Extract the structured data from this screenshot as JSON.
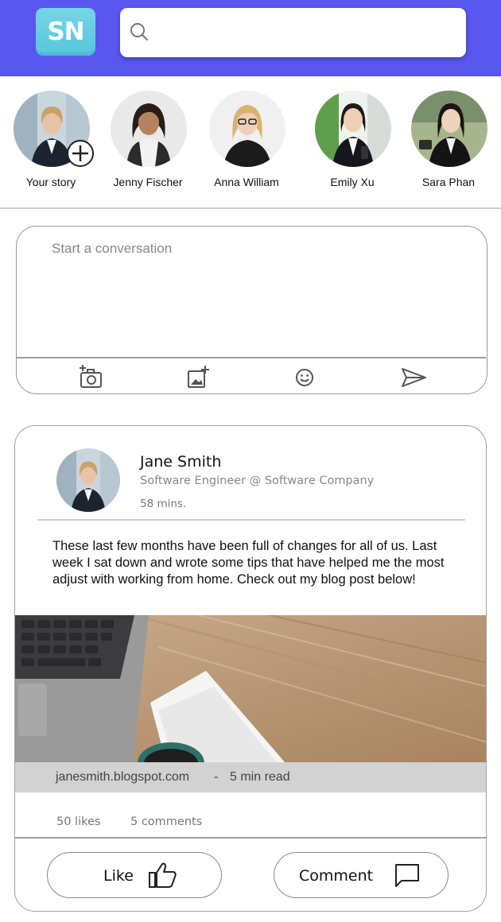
{
  "header": {
    "logo_text": "SN",
    "brand_color": "#5a56f0",
    "search": {
      "value": "",
      "placeholder": "",
      "icon": "search-icon"
    }
  },
  "stories": [
    {
      "label": "Your story",
      "is_own": true,
      "badge_icon": "plus-icon"
    },
    {
      "label": "Jenny Fischer"
    },
    {
      "label": "Anna William"
    },
    {
      "label": "Emily Xu"
    },
    {
      "label": "Sara Phan"
    }
  ],
  "composer": {
    "placeholder": "Start a conversation",
    "tools": [
      "camera-add-icon",
      "image-add-icon",
      "emoji-icon",
      "send-icon"
    ]
  },
  "post": {
    "author_name": "Jane Smith",
    "author_title": "Software Engineer @ Software Company",
    "time": "58 mins.",
    "body": "These last few months have been full of changes for all of us. Last week I sat down and wrote some tips that have helped me the most adjust with working from home. Check out my blog post below!",
    "link_url": "janesmith.blogspot.com",
    "link_separator": "-",
    "link_read_time": "5 min read",
    "likes": "50 likes",
    "comments": "5 comments",
    "like_label": "Like",
    "comment_label": "Comment"
  }
}
